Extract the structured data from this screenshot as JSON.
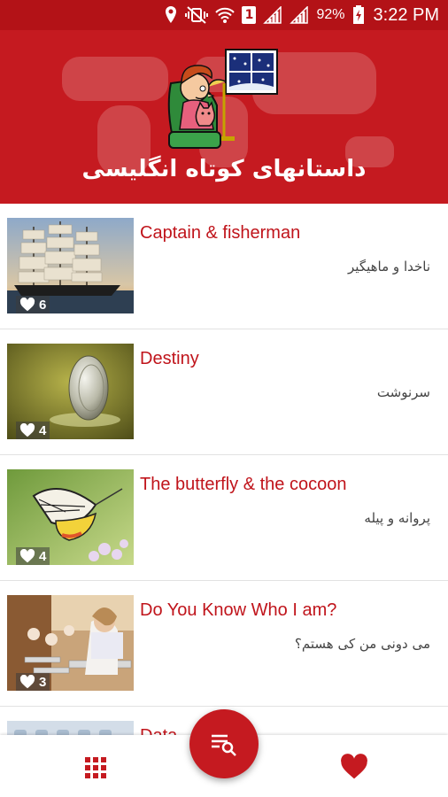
{
  "status_bar": {
    "battery_percent": "92%",
    "sim_badge": "1",
    "time": "3:22 PM"
  },
  "header": {
    "title": "داستانهای کوتاه انگلیسی"
  },
  "stories": [
    {
      "title_en": "Captain & fisherman",
      "title_fa": "ناخدا و ماهیگیر",
      "likes": "6",
      "thumb": "ship"
    },
    {
      "title_en": "Destiny",
      "title_fa": "سرنوشت",
      "likes": "4",
      "thumb": "coin"
    },
    {
      "title_en": "The butterfly & the cocoon",
      "title_fa": "پروانه و پیله",
      "likes": "4",
      "thumb": "butterfly"
    },
    {
      "title_en": "Do You Know Who I am?",
      "title_fa": "می دونی من کی هستم؟",
      "likes": "3",
      "thumb": "classroom"
    },
    {
      "title_en": "Data",
      "title_fa": "",
      "likes": "",
      "thumb": "partial"
    }
  ],
  "colors": {
    "primary": "#c51a20",
    "status_bar": "#b31217",
    "title_text": "#c0141b"
  },
  "bottom_nav": {
    "left_icon": "grid-icon",
    "center_icon": "search-list-icon",
    "right_icon": "heart-icon"
  }
}
